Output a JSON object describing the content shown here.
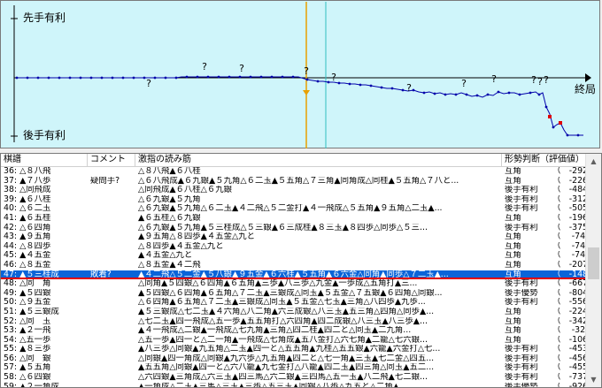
{
  "graph": {
    "label_top": "先手有利",
    "label_bottom": "後手有利",
    "label_end": "終局",
    "question_mark": "?",
    "colors": {
      "background": "#cff5fa",
      "line": "#0000aa",
      "current": "#e8a000",
      "cursor": "#30c0c0",
      "marker": "#e00000"
    }
  },
  "list": {
    "headers": [
      "棋譜",
      "コメント",
      "激指の読み筋",
      "形勢判断（評価値）"
    ],
    "rows": [
      {
        "move": "36: △８八飛",
        "comment": "",
        "pv": "△８八飛▲６八桂",
        "judge": "互角",
        "score": "（　-292）"
      },
      {
        "move": "37: ▲７八歩",
        "comment": "疑問手?",
        "pv": "△６八飛成▲６九銀▲５九角△６二玉▲５五角△７三角▲同角成△同桂▲５五角△７八と...",
        "judge": "互角",
        "score": "（　-226）"
      },
      {
        "move": "38: △同飛成",
        "comment": "",
        "pv": "△同飛成▲６八桂△６九銀",
        "judge": "後手有利",
        "score": "（　-484）"
      },
      {
        "move": "39: ▲６八桂",
        "comment": "",
        "pv": "△６九銀▲５九角",
        "judge": "後手有利",
        "score": "（　-312）"
      },
      {
        "move": "40: △６二玉",
        "comment": "",
        "pv": "△６九銀▲５九角△６二玉▲４二飛△５二金打▲４一飛成△５五角▲９五角△二玉▲...",
        "judge": "後手有利",
        "score": "（　-505）"
      },
      {
        "move": "41: ▲６五桂",
        "comment": "",
        "pv": "▲６五桂△６九銀",
        "judge": "互角",
        "score": "（　-196）"
      },
      {
        "move": "42: △６四角",
        "comment": "",
        "pv": "△６九銀▲５九角▲５三桂成△５三銀▲６三成桂▲８三玉▲８四歩△同歩△５三...",
        "judge": "後手有利",
        "score": "（　-375）"
      },
      {
        "move": "43: ▲９五角",
        "comment": "",
        "pv": "▲９五角△８四歩▲４五金△九と",
        "judge": "互角",
        "score": "（　 -74）"
      },
      {
        "move": "44: △８四歩",
        "comment": "",
        "pv": "△８四歩▲４五金△九と",
        "judge": "互角",
        "score": "（　 -74）"
      },
      {
        "move": "45: ▲４五金",
        "comment": "",
        "pv": "▲４五金△九と",
        "judge": "互角",
        "score": "（　 -74）"
      },
      {
        "move": "46: △８五金",
        "comment": "",
        "pv": "△８五金▲４二飛",
        "judge": "互角",
        "score": "（　-207）"
      },
      {
        "move": "47: ▲５三桂成",
        "comment": "敗着?",
        "pv": "▲４二飛△５二金▲５八銀▲９五金▲６六桂▲５五角▲６六金△同角▲同歩△７二玉▲...",
        "judge": "互角",
        "score": "（　-148）",
        "selected": true
      },
      {
        "move": "48: △同　角",
        "comment": "",
        "pv": "△同角▲５四銀△６四角▲６五角▲三歩▲八三歩△九金▲一歩成△五角打▲三...",
        "judge": "後手有利",
        "score": "（　-667）"
      },
      {
        "move": "49: ▲５四銀",
        "comment": "",
        "pv": "▲５四銀△６四角▲６五角△７二玉▲三銀成△同玉▲５五金△７五銀▲６四角△同銀...",
        "judge": "後手優勢",
        "score": "（　-804）"
      },
      {
        "move": "50: △９五金",
        "comment": "",
        "pv": "△６四角▲６五角△７二玉▲三銀成△同玉▲５五金△七玉▲三角△八四歩▲九歩...",
        "judge": "後手有利",
        "score": "（　-556）"
      },
      {
        "move": "51: ▲５三銀成",
        "comment": "",
        "pv": "▲５三銀成△七二玉▲４六角△八二角▲六三成銀△八三玉▲五三角△四角△同歩▲...",
        "judge": "互角",
        "score": "（　-224）"
      },
      {
        "move": "52: △同　玉",
        "comment": "",
        "pv": "△七二玉▲四一飛成△五一歩▲五五角打△六四角▲四二成銀△八三玉▲八三歩▲...",
        "judge": "互角",
        "score": "（　-342）"
      },
      {
        "move": "53: ▲２一飛",
        "comment": "",
        "pv": "▲４一飛成△二銀▲一飛成△七九角▲三角△四二桂▲四二と△同玉▲二九角...",
        "judge": "互角",
        "score": "（　 -32）"
      },
      {
        "move": "54: △五一歩",
        "comment": "",
        "pv": "△五一歩▲四一と△二一角▲一飛成△七角成▲五八金打△六七角▲二籠△七六銀...",
        "judge": "互角",
        "score": "（　-106）"
      },
      {
        "move": "55: ▲８三歩",
        "comment": "",
        "pv": "▲八三歩△同銀▲九五角△二玉▲四一と△五五角▲九桂△五五銀▲六籠▲六金打△七...",
        "judge": "後手有利",
        "score": "（　-453）"
      },
      {
        "move": "56: △同　銀",
        "comment": "",
        "pv": "△同銀▲四一角成△同銀▲九六歩△九五角▲四二と△七一角▲三玉▲七二金△四五...",
        "judge": "後手有利",
        "score": "（　-456）"
      },
      {
        "move": "57: ▲５五角",
        "comment": "",
        "pv": "▲五五角△同銀▲四一と△六八籠▲九七金打△八籠▲四二玉▲四三角△同玉▲五二...",
        "judge": "後手有利",
        "score": "（　-455）"
      },
      {
        "move": "58: △６四銀",
        "comment": "",
        "pv": "△六四銀▲三角成△六三玉▲四三馬△六二銀▲三四馬△五一玉▲八二飛▲七二銀...",
        "judge": "後手有利",
        "score": "（　-737）"
      },
      {
        "move": "59: ▲２一角成",
        "comment": "",
        "pv": "▲一角成△二玉▲三馬△三玉▲三歩△五三玉▲同銀△八歩△九五と△二角▲...",
        "judge": "後手優勢",
        "score": "（　-926）"
      }
    ]
  },
  "scrollbar": {
    "up": "▲",
    "down": "▼"
  }
}
